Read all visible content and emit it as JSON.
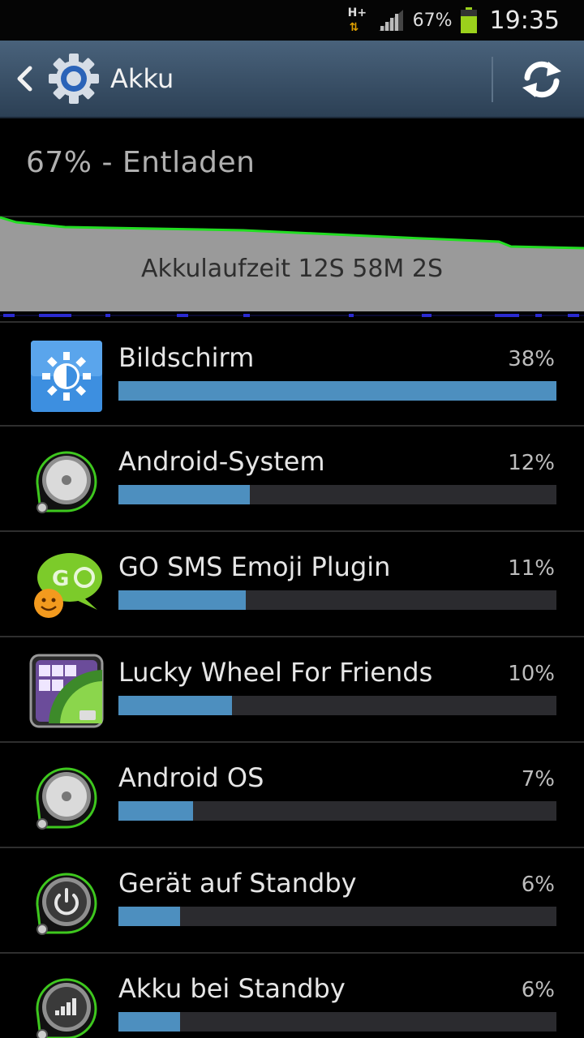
{
  "status_bar": {
    "network_type": "H+",
    "battery_percent": "67%",
    "time": "19:35",
    "battery_icon": "battery-icon",
    "signal_icon": "signal-icon"
  },
  "action_bar": {
    "title": "Akku",
    "back_icon": "chevron-left-icon",
    "app_icon": "settings-gear-icon",
    "refresh_icon": "refresh-icon"
  },
  "battery": {
    "state_text": "67% - Entladen",
    "runtime_text": "Akkulaufzeit 12S 58M 2S"
  },
  "colors": {
    "accent_bar": "#4d8fbf",
    "graph_line": "#22dd22",
    "graph_fill": "#9a9a9a"
  },
  "usage": [
    {
      "name": "Bildschirm",
      "percent_label": "38%",
      "fraction": 1.0,
      "icon": "display-brightness-icon"
    },
    {
      "name": "Android-System",
      "percent_label": "12%",
      "fraction": 0.3,
      "icon": "android-system-icon"
    },
    {
      "name": "GO SMS Emoji Plugin",
      "percent_label": "11%",
      "fraction": 0.29,
      "icon": "go-sms-emoji-icon"
    },
    {
      "name": "Lucky Wheel For Friends",
      "percent_label": "10%",
      "fraction": 0.26,
      "icon": "lucky-wheel-icon"
    },
    {
      "name": "Android OS",
      "percent_label": "7%",
      "fraction": 0.17,
      "icon": "android-os-icon"
    },
    {
      "name": "Gerät auf Standby",
      "percent_label": "6%",
      "fraction": 0.14,
      "icon": "standby-power-icon"
    },
    {
      "name": "Akku bei Standby",
      "percent_label": "6%",
      "fraction": 0.14,
      "icon": "cell-standby-icon"
    }
  ]
}
